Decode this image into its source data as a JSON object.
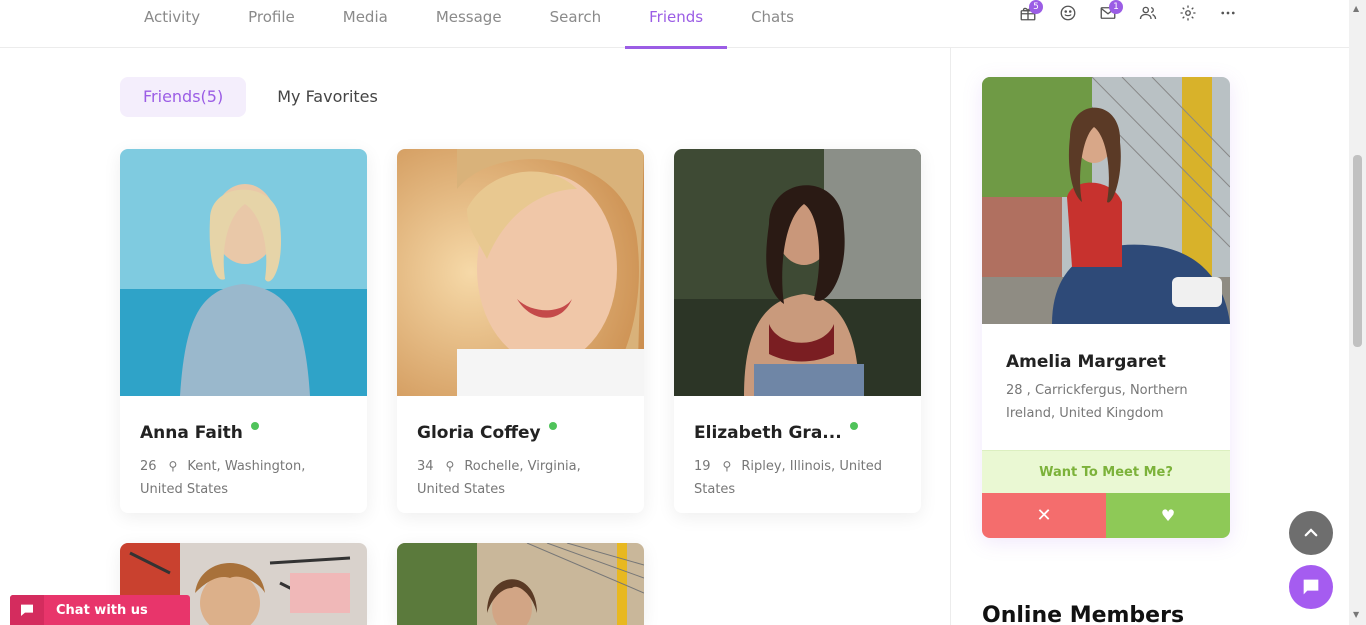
{
  "nav": {
    "tabs": [
      {
        "label": "Activity"
      },
      {
        "label": "Profile"
      },
      {
        "label": "Media"
      },
      {
        "label": "Message"
      },
      {
        "label": "Search"
      },
      {
        "label": "Friends",
        "active": true
      },
      {
        "label": "Chats"
      }
    ],
    "icons": [
      {
        "name": "gift-icon",
        "badge": "5"
      },
      {
        "name": "smiley-icon",
        "badge": ""
      },
      {
        "name": "mail-icon",
        "badge": "1"
      },
      {
        "name": "users-icon",
        "badge": ""
      },
      {
        "name": "gear-icon",
        "badge": ""
      },
      {
        "name": "more-icon",
        "badge": ""
      }
    ]
  },
  "subtabs": {
    "friends": "Friends(5)",
    "favorites": "My Favorites"
  },
  "friends": [
    {
      "name": "Anna Faith",
      "age": "26",
      "location": "Kent, Washington, United States"
    },
    {
      "name": "Gloria Coffey",
      "age": "34",
      "location": "Rochelle, Virginia, United States"
    },
    {
      "name": "Elizabeth Gra...",
      "age": "19",
      "location": "Ripley, Illinois, United States"
    }
  ],
  "meet": {
    "name": "Amelia Margaret",
    "meta": "28 , Carrickfergus, Northern Ireland, United Kingdom",
    "prompt": "Want To Meet Me?",
    "no": "✕",
    "yes": "♥"
  },
  "online_members": "Online Members",
  "chat_widget": {
    "label": "Chat with us"
  },
  "colors": {
    "accent": "#9b5de5",
    "online": "#4fc35a",
    "reject": "#f46d6d",
    "accept": "#8ec957",
    "chat": "#e8356b"
  }
}
